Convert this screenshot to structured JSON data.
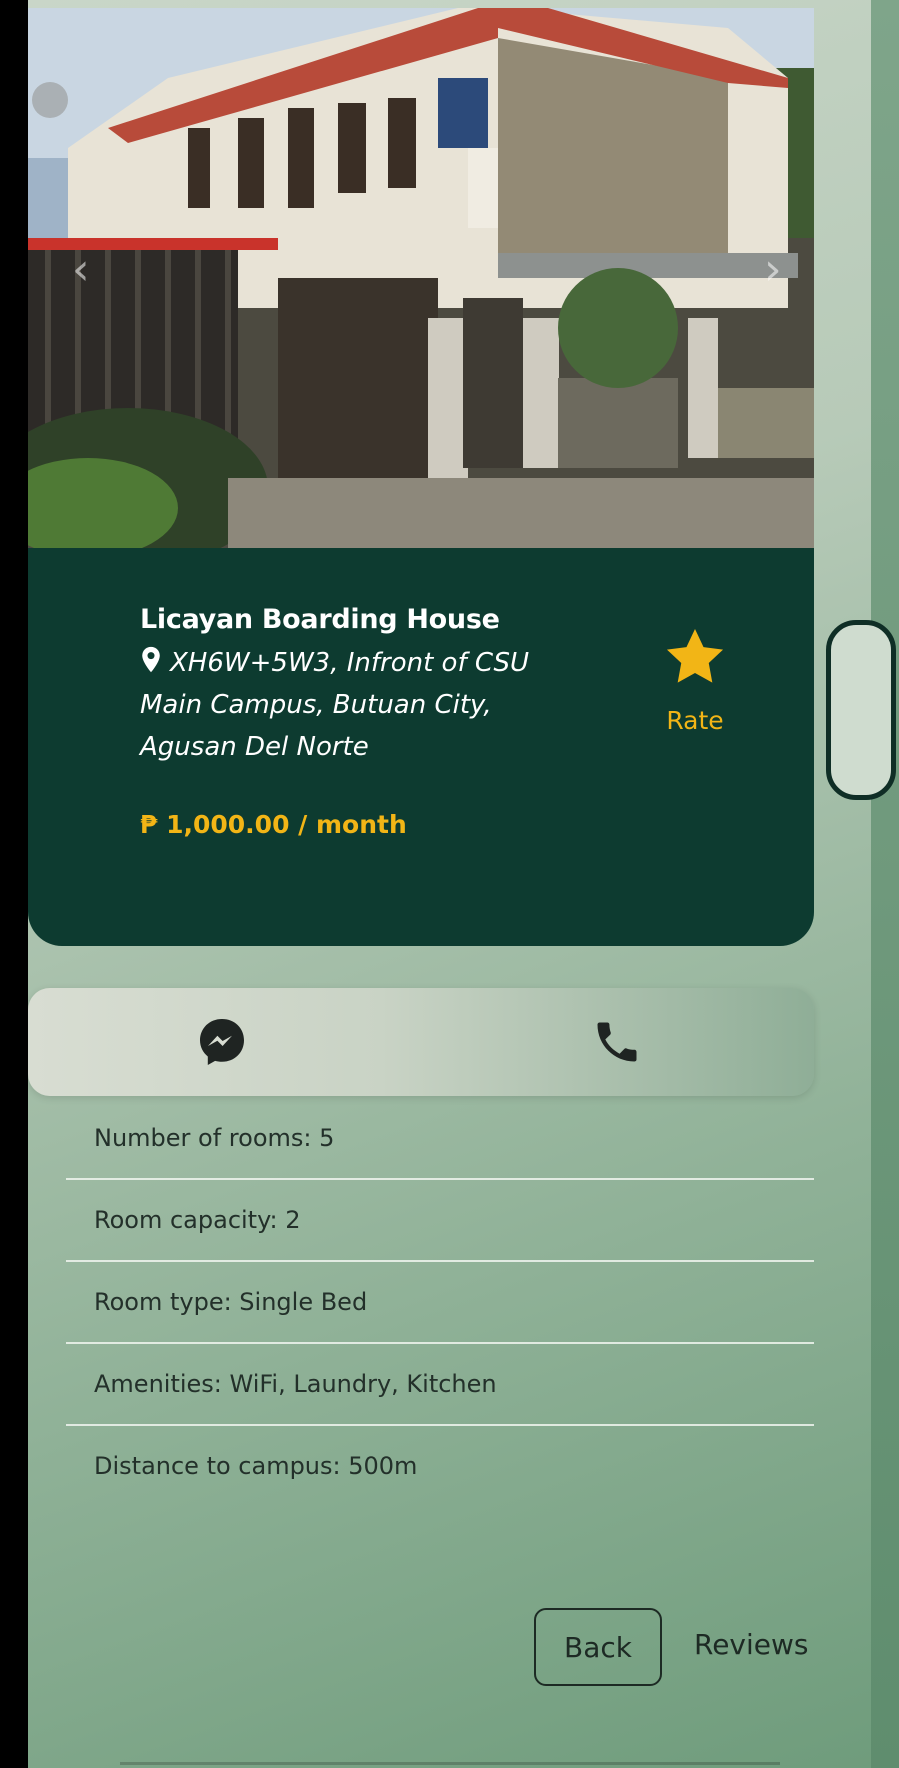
{
  "listing": {
    "name": "Licayan Boarding House",
    "address": "XH6W+5W3, Infront of CSU Main Campus, Butuan City, Agusan Del Norte",
    "price": "₱ 1,000.00 / month",
    "rate_label": "Rate"
  },
  "contact": {
    "messenger_icon": "messenger-icon",
    "phone_icon": "phone-icon"
  },
  "details": [
    "Number of rooms: 5",
    "Room capacity: 2",
    "Room type: Single Bed",
    "Amenities: WiFi, Laundry, Kitchen",
    "Distance to campus: 500m"
  ],
  "actions": {
    "back_label": "Back",
    "reviews_label": "Reviews"
  },
  "colors": {
    "card_bg": "#0d3b30",
    "accent": "#f2b516"
  }
}
